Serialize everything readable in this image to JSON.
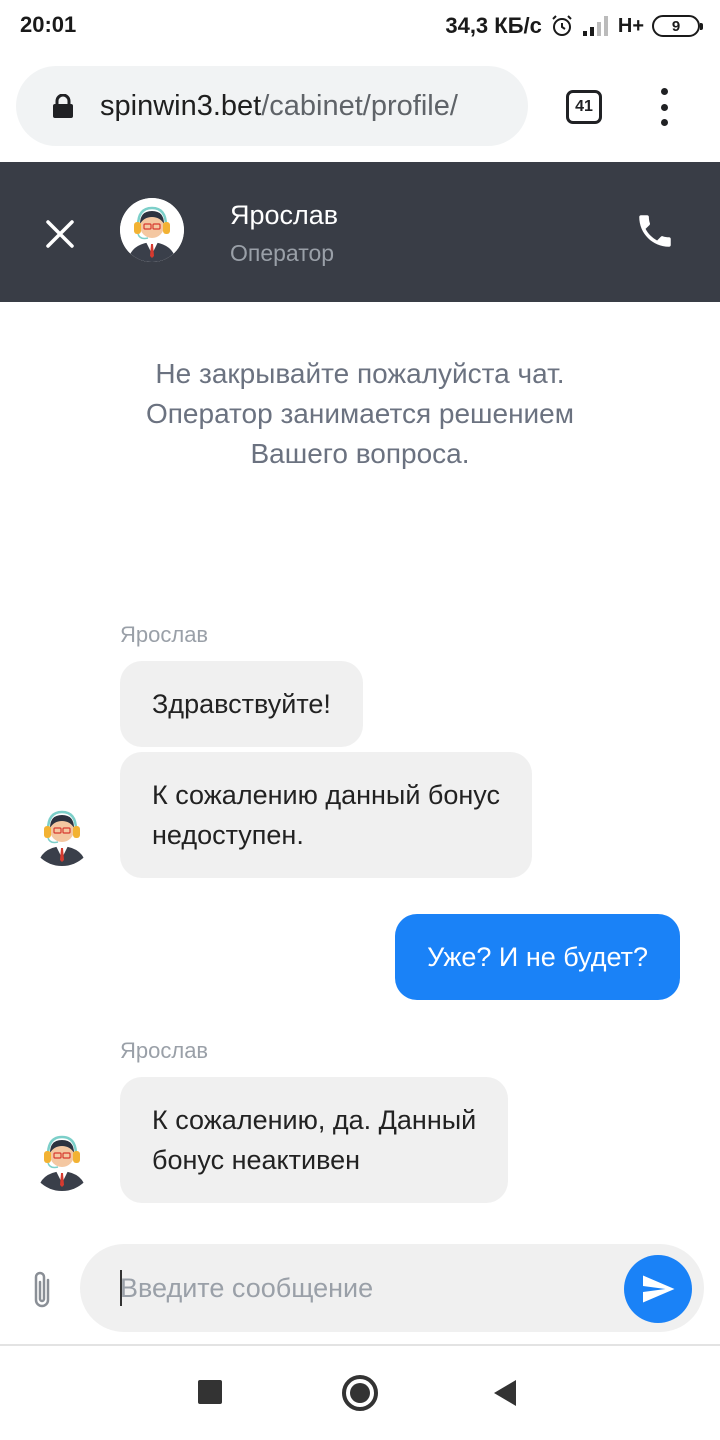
{
  "status_bar": {
    "time": "20:01",
    "speed": "34,3 КБ/с",
    "network": "H+",
    "battery": "9"
  },
  "browser": {
    "url_host": "spinwin3.bet",
    "url_path": "/cabinet/profile/",
    "tab_count": "41"
  },
  "chat": {
    "operator_name": "Ярослав",
    "operator_role": "Оператор",
    "notice_lines": [
      "Не закрывайте пожалуйста чат.",
      "Оператор занимается решением",
      "Вашего вопроса."
    ],
    "messages": [
      {
        "sender": "Ярослав",
        "text": "Здравствуйте!"
      },
      {
        "text_lines": [
          "К сожалению данный бонус",
          "недоступен."
        ]
      },
      {
        "text": "Уже? И не будет?"
      },
      {
        "sender": "Ярослав",
        "text_lines": [
          "К сожалению, да. Данный",
          "бонус неактивен"
        ]
      }
    ],
    "input_placeholder": "Введите сообщение"
  },
  "colors": {
    "header_bg": "#393d46",
    "outgoing_bubble": "#1a82f7",
    "incoming_bubble": "#f0f0f0",
    "send_button": "#1a82f7"
  },
  "icons": [
    "lock-icon",
    "close-icon",
    "phone-icon",
    "operator-avatar",
    "paperclip-icon",
    "send-icon",
    "recent-apps-icon",
    "home-icon",
    "back-icon"
  ]
}
